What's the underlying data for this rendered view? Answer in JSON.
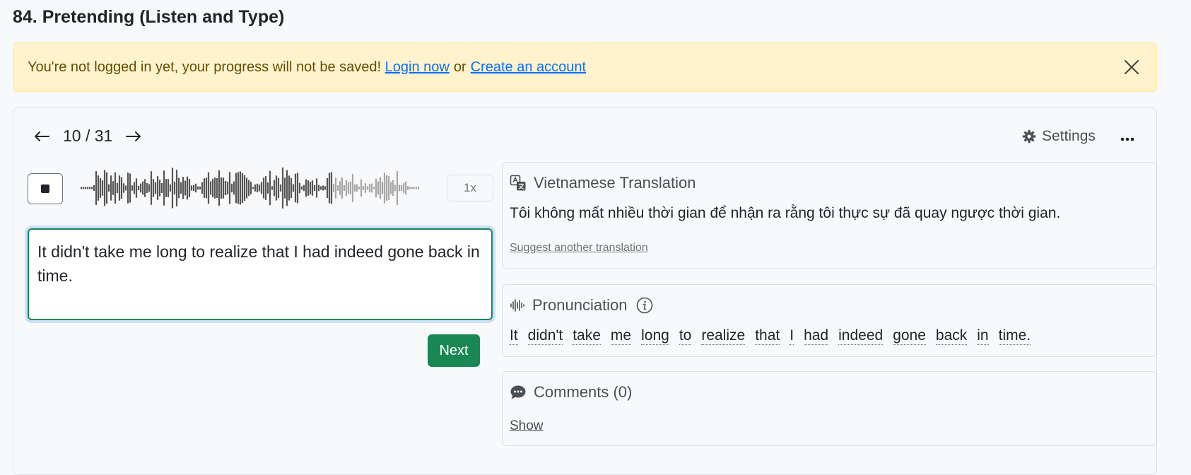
{
  "page": {
    "title": "84. Pretending (Listen and Type)"
  },
  "alert": {
    "message": "You're not logged in yet, your progress will not be saved!",
    "login_link": "Login now",
    "separator": "or",
    "create_link": "Create an account"
  },
  "nav": {
    "counter": "10 / 31",
    "settings_label": "Settings"
  },
  "player": {
    "speed": "1x"
  },
  "answer": {
    "value": "It didn't take me long to realize that I had indeed gone back in time."
  },
  "actions": {
    "next_label": "Next"
  },
  "translation": {
    "heading": "Vietnamese Translation",
    "text": "Tôi không mất nhiều thời gian để nhận ra rằng tôi thực sự đã quay ngược thời gian.",
    "suggest_link": "Suggest another translation"
  },
  "pronunciation": {
    "heading": "Pronunciation",
    "words": [
      "It",
      "didn't",
      "take",
      "me",
      "long",
      "to",
      "realize",
      "that",
      "I",
      "had",
      "indeed",
      "gone",
      "back",
      "in",
      "time."
    ]
  },
  "comments": {
    "heading": "Comments (0)",
    "show_link": "Show"
  },
  "colors": {
    "success": "#198754",
    "alert_bg": "#fff3cd",
    "link": "#0d6efd",
    "focus": "#86b7fe"
  },
  "icons": [
    "close-icon",
    "arrow-left-icon",
    "arrow-right-icon",
    "gear-icon",
    "more-icon",
    "stop-icon",
    "translate-icon",
    "audio-wave-icon",
    "info-icon",
    "comment-icon"
  ]
}
